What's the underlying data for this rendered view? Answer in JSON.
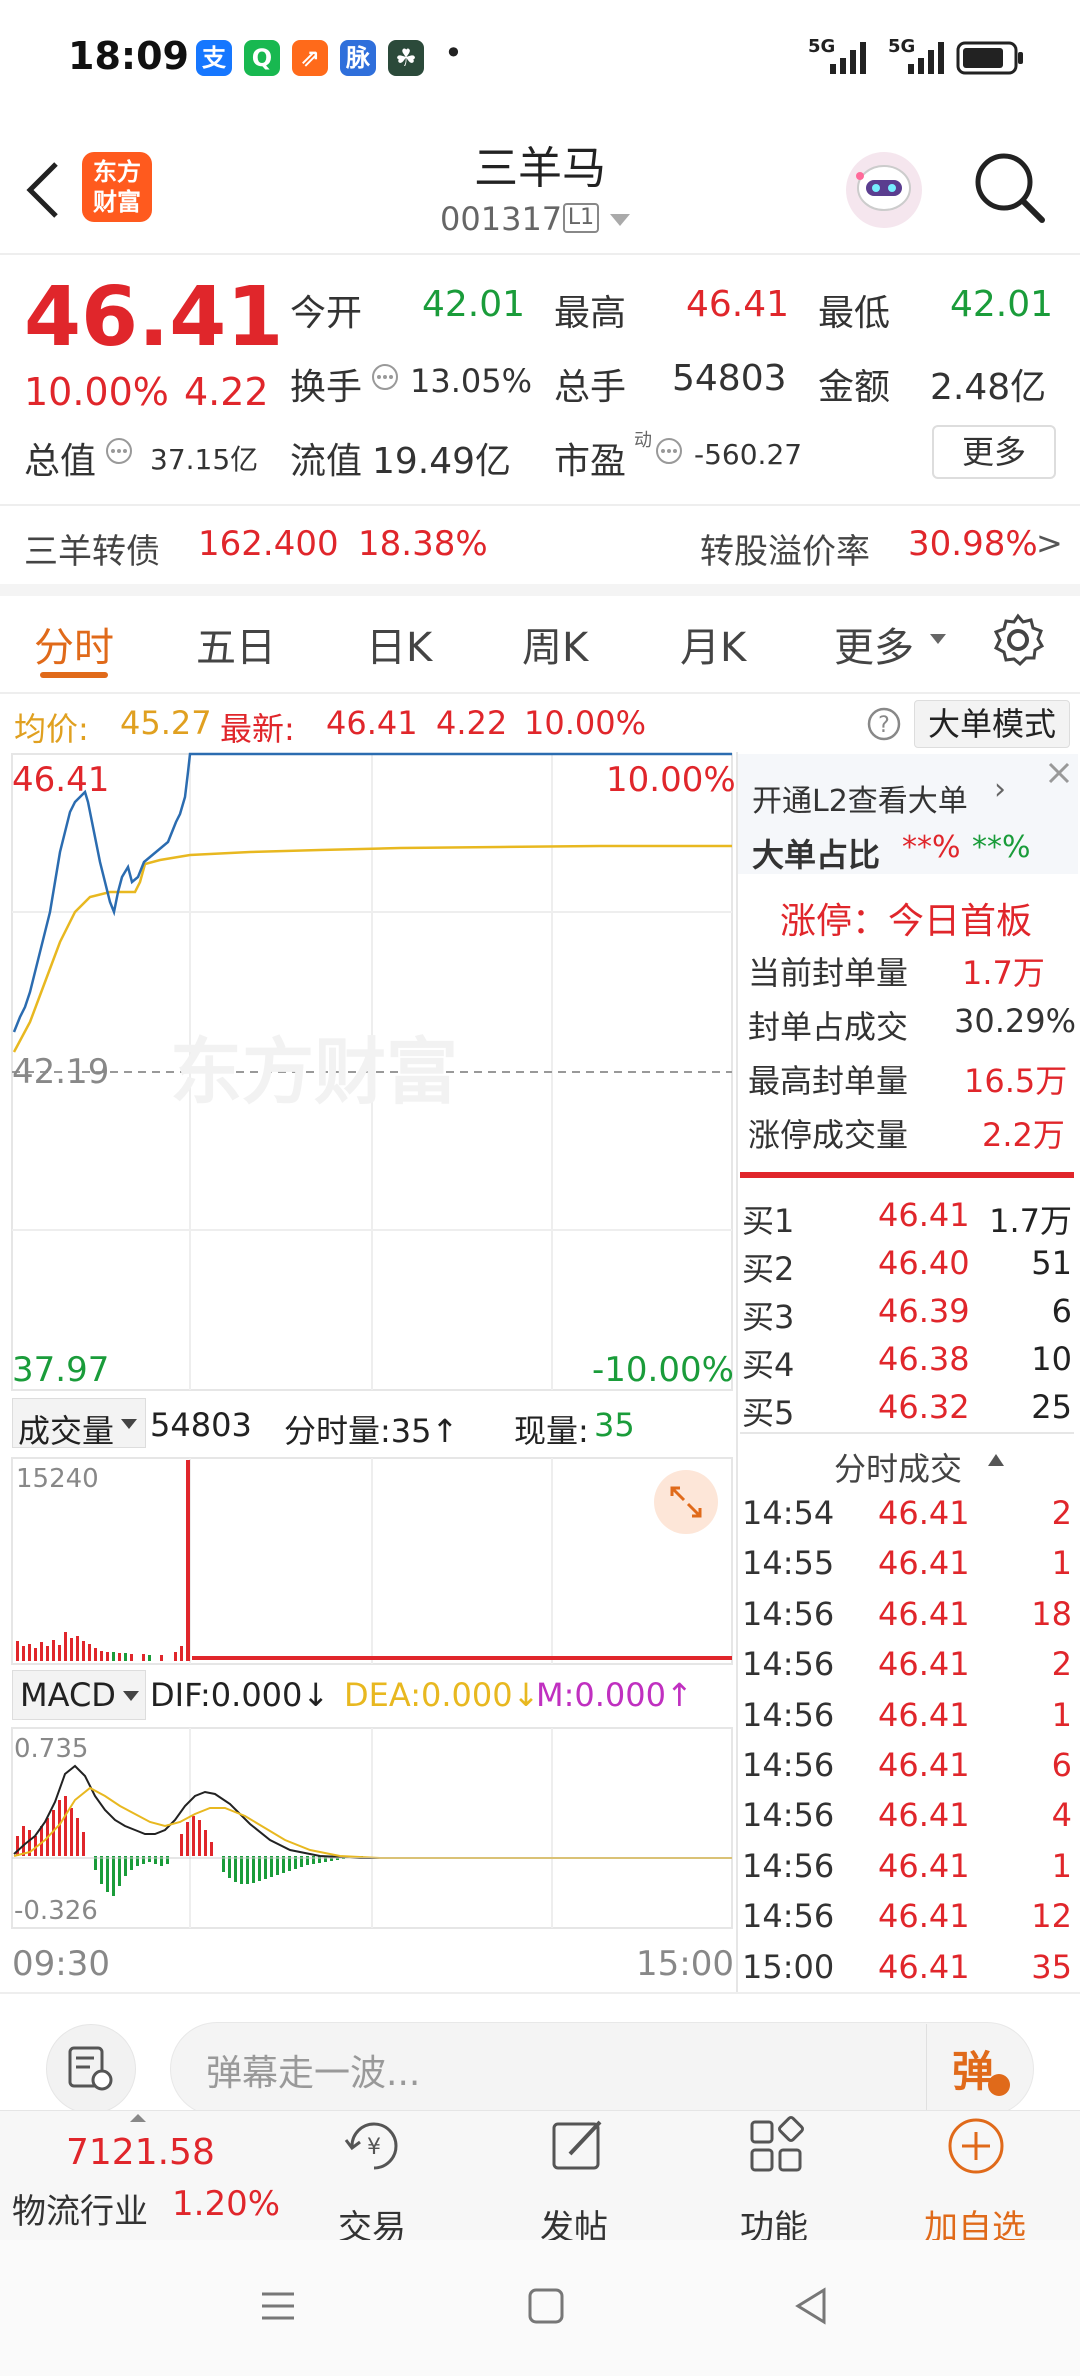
{
  "status_bar": {
    "time": "18:09",
    "app_icons": [
      {
        "label": "支",
        "color": "#1677ff"
      },
      {
        "label": "Q",
        "color": "#18b850"
      },
      {
        "label": "⇗",
        "color": "#ff6a1a"
      },
      {
        "label": "脉",
        "color": "#2f6fdb"
      },
      {
        "label": "☘",
        "color": "#2b4a3a"
      }
    ],
    "dot": "•",
    "signal1": "5G",
    "signal2": "5G"
  },
  "header": {
    "back_icon": "chevron-left-icon",
    "logo_line1": "东方",
    "logo_line2": "财富",
    "stock_name": "三羊马",
    "stock_code": "001317",
    "level_badge": "L1",
    "search_icon": "search-icon"
  },
  "quote": {
    "price": "46.41",
    "change_pct": "10.00%",
    "change_abs": "4.22",
    "open_label": "今开",
    "open_value": "42.01",
    "high_label": "最高",
    "high_value": "46.41",
    "low_label": "最低",
    "low_value": "42.01",
    "turnover_label": "换手",
    "turnover_value": "13.05%",
    "volume_label": "总手",
    "volume_value": "54803",
    "amount_label": "金额",
    "amount_value": "2.48亿",
    "mktcap_label": "总值",
    "mktcap_value": "37.15亿",
    "float_label": "流值",
    "float_value": "19.49亿",
    "pe_label": "市盈",
    "pe_super": "动",
    "pe_value": "-560.27",
    "more_button": "更多"
  },
  "bond": {
    "name": "三羊转债",
    "price": "162.400",
    "pct": "18.38%",
    "premium_label": "转股溢价率",
    "premium_value": "30.98%",
    "arrow": ">"
  },
  "tabs": {
    "items": [
      "分时",
      "五日",
      "日K",
      "周K",
      "月K"
    ],
    "more": "更多",
    "active": "分时"
  },
  "chart_info": {
    "avg_label": "均价:",
    "avg_value": "45.27",
    "last_label": "最新:",
    "last_value": "46.41",
    "last_change": "4.22",
    "last_pct": "10.00%",
    "mode_button": "大单模式"
  },
  "price_chart": {
    "top_price": "46.41",
    "top_pct": "10.00%",
    "mid_price": "42.19",
    "bottom_price": "37.97",
    "bottom_pct": "-10.00%",
    "watermark": "东方财富"
  },
  "volume_info": {
    "label": "成交量",
    "total": "54803",
    "minute_label": "分时量:35↑",
    "now_label": "现量:",
    "now_value": "35",
    "max_tick": "15240"
  },
  "macd_info": {
    "label": "MACD",
    "dif": "DIF:0.000↓",
    "dea": "DEA:0.000↓",
    "m": "M:0.000↑",
    "top_tick": "0.735",
    "bottom_tick": "-0.326",
    "time_start": "09:30",
    "time_end": "15:00"
  },
  "right_panel": {
    "l2_link": "开通L2查看大单",
    "big_order_label": "大单占比",
    "big_order_v1": "**%",
    "big_order_v2": "**%",
    "limit_title": "涨停：今日首板",
    "stats": [
      {
        "label": "当前封单量",
        "value": "1.7万"
      },
      {
        "label": "封单占成交",
        "value": "30.29%"
      },
      {
        "label": "最高封单量",
        "value": "16.5万"
      },
      {
        "label": "涨停成交量",
        "value": "2.2万"
      }
    ],
    "bids": [
      {
        "label": "买1",
        "price": "46.41",
        "qty": "1.7万"
      },
      {
        "label": "买2",
        "price": "46.40",
        "qty": "51"
      },
      {
        "label": "买3",
        "price": "46.39",
        "qty": "6"
      },
      {
        "label": "买4",
        "price": "46.38",
        "qty": "10"
      },
      {
        "label": "买5",
        "price": "46.32",
        "qty": "25"
      }
    ],
    "trades_title": "分时成交",
    "trades": [
      {
        "time": "14:54",
        "price": "46.41",
        "qty": "2"
      },
      {
        "time": "14:55",
        "price": "46.41",
        "qty": "1"
      },
      {
        "time": "14:56",
        "price": "46.41",
        "qty": "18"
      },
      {
        "time": "14:56",
        "price": "46.41",
        "qty": "2"
      },
      {
        "time": "14:56",
        "price": "46.41",
        "qty": "1"
      },
      {
        "time": "14:56",
        "price": "46.41",
        "qty": "6"
      },
      {
        "time": "14:56",
        "price": "46.41",
        "qty": "4"
      },
      {
        "time": "14:56",
        "price": "46.41",
        "qty": "1"
      },
      {
        "time": "14:56",
        "price": "46.41",
        "qty": "12"
      },
      {
        "time": "15:00",
        "price": "46.41",
        "qty": "35"
      }
    ]
  },
  "comment_bar": {
    "placeholder": "弹幕走一波...",
    "danmaku_button": "弹"
  },
  "bottom_nav": {
    "index_value": "7121.58",
    "sector_name": "物流行业",
    "sector_pct": "1.20%",
    "trade": "交易",
    "post": "发帖",
    "function": "功能",
    "add": "加自选"
  }
}
